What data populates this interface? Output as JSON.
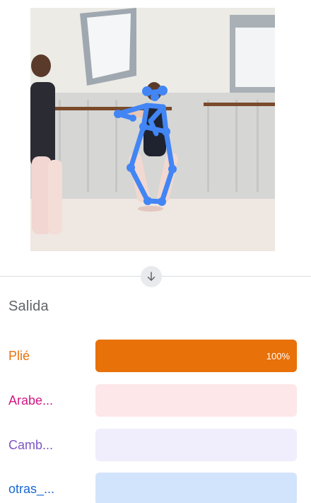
{
  "output": {
    "title": "Salida"
  },
  "icons": {
    "arrow": "arrow-down-icon"
  },
  "colors": {
    "pose_skeleton": "#4285f4",
    "divider": "#dadce0"
  },
  "predictions": [
    {
      "label": "Plié",
      "value": 1.0,
      "percent_text": "100%",
      "text_color": "#e8710a",
      "track_color": "#e8710a",
      "fill_color": "#e8710a"
    },
    {
      "label": "Arabe...",
      "value": 0.0,
      "percent_text": "",
      "text_color": "#d01884",
      "track_color": "#fde7e9",
      "fill_color": "#d01884"
    },
    {
      "label": "Camb...",
      "value": 0.0,
      "percent_text": "",
      "text_color": "#7e57c2",
      "track_color": "#f0eefc",
      "fill_color": "#7e57c2"
    },
    {
      "label": "otras_...",
      "value": 0.0,
      "percent_text": "",
      "text_color": "#1967d2",
      "track_color": "#d2e3fc",
      "fill_color": "#1967d2"
    }
  ]
}
